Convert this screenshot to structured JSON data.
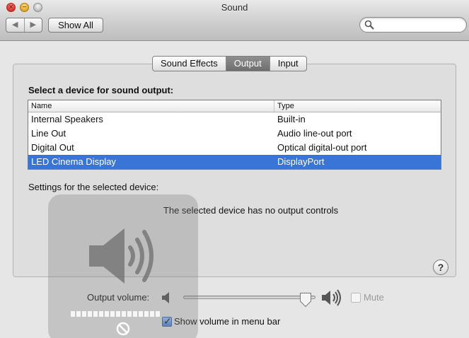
{
  "window": {
    "title": "Sound",
    "close_glyph": "×",
    "min_glyph": "−",
    "nav_back": "◀",
    "nav_forward": "▶",
    "show_all_label": "Show All",
    "search_placeholder": "",
    "search_icon": "magnifier-icon"
  },
  "tabs": [
    {
      "label": "Sound Effects",
      "active": false
    },
    {
      "label": "Output",
      "active": true
    },
    {
      "label": "Input",
      "active": false
    }
  ],
  "output": {
    "section_label": "Select a device for sound output:",
    "columns": {
      "name": "Name",
      "type": "Type"
    },
    "devices": [
      {
        "name": "Internal Speakers",
        "type": "Built-in",
        "selected": false
      },
      {
        "name": "Line Out",
        "type": "Audio line-out port",
        "selected": false
      },
      {
        "name": "Digital Out",
        "type": "Optical digital-out port",
        "selected": false
      },
      {
        "name": "LED Cinema Display",
        "type": "DisplayPort",
        "selected": true
      }
    ],
    "settings_label": "Settings for the selected device:",
    "no_controls_message": "The selected device has no output controls",
    "help_glyph": "?"
  },
  "volume": {
    "label": "Output volume:",
    "level": 0.95,
    "mute_label": "Mute",
    "mute_checked": false,
    "show_in_menubar_label": "Show volume in menu bar",
    "show_in_menubar_checked": true,
    "check_glyph": "✓"
  },
  "hud": {
    "icon": "speaker-volume-icon",
    "bar_count": 16,
    "disabled_icon": "no-entry-icon"
  },
  "colors": {
    "selection": "#3875d7",
    "active_tab": "#7a7a7a"
  }
}
